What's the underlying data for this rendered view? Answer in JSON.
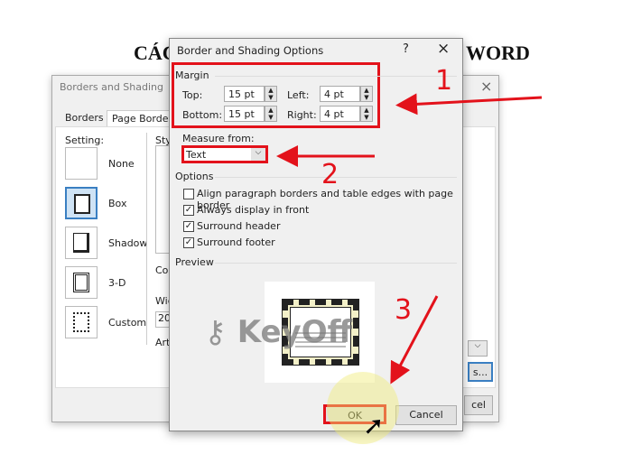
{
  "heading": {
    "left": "CÁC",
    "right": "WORD"
  },
  "back_dialog": {
    "title": "Borders and Shading",
    "tabs": [
      "Borders",
      "Page Border"
    ],
    "setting_label": "Setting:",
    "settings": [
      "None",
      "Box",
      "Shadow",
      "3-D",
      "Custom"
    ],
    "partial_labels": {
      "style": "Sty",
      "color": "Col",
      "width": "Wic",
      "width_value": "20",
      "art": "Art"
    },
    "options_button": "s...",
    "cancel": "cel"
  },
  "front_dialog": {
    "title": "Border and Shading Options",
    "help": "?",
    "close": "×",
    "margin": {
      "label": "Margin",
      "top_label": "Top:",
      "top": "15 pt",
      "bottom_label": "Bottom:",
      "bottom": "15 pt",
      "left_label": "Left:",
      "left": "4 pt",
      "right_label": "Right:",
      "right": "4 pt"
    },
    "measure_from": {
      "label": "Measure from:",
      "value": "Text"
    },
    "options": {
      "label": "Options",
      "items": [
        {
          "label": "Align paragraph borders and table edges with page border",
          "checked": false
        },
        {
          "label": "Always display in front",
          "checked": true
        },
        {
          "label": "Surround header",
          "checked": true
        },
        {
          "label": "Surround footer",
          "checked": true
        }
      ]
    },
    "preview_label": "Preview",
    "ok": "OK",
    "cancel": "Cancel"
  },
  "annotations": {
    "step1": "1",
    "step2": "2",
    "step3": "3",
    "color": "#e3121b"
  },
  "watermark": "KeyOff"
}
